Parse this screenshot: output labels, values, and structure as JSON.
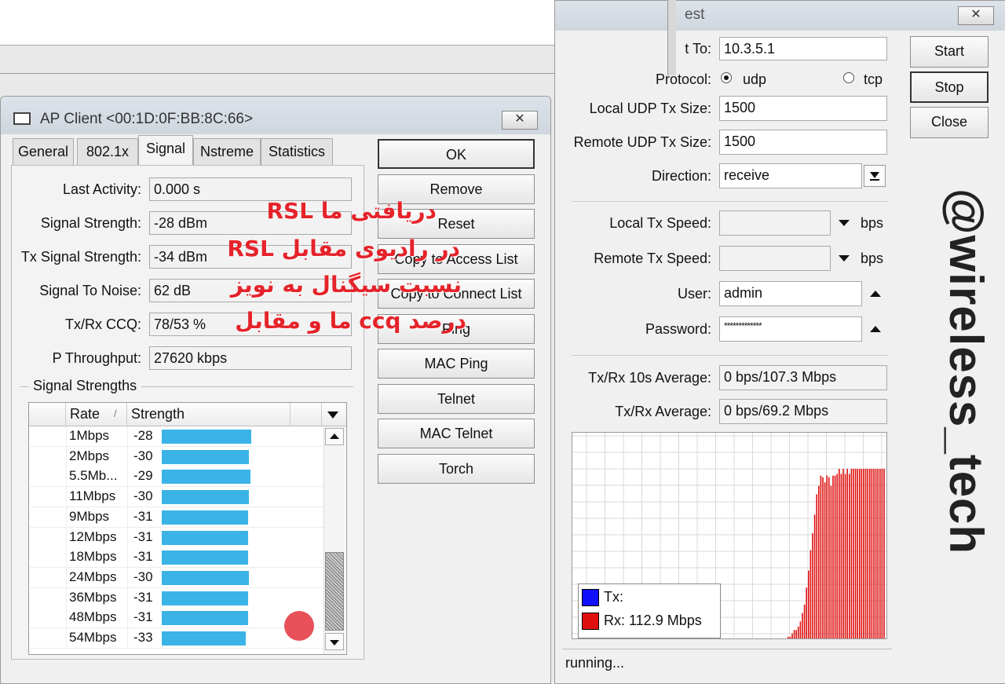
{
  "apclient": {
    "title": "AP Client <00:1D:0F:BB:8C:66>",
    "close_glyph": "✕",
    "tabs": [
      "General",
      "802.1x",
      "Signal",
      "Nstreme",
      "Statistics"
    ],
    "fields": [
      {
        "label": "Last Activity:",
        "value": "0.000 s"
      },
      {
        "label": "Signal Strength:",
        "value": "-28 dBm"
      },
      {
        "label": "Tx Signal Strength:",
        "value": "-34 dBm"
      },
      {
        "label": "Signal To Noise:",
        "value": "62 dB"
      },
      {
        "label": "Tx/Rx CCQ:",
        "value": "78/53 %"
      },
      {
        "label": "P Throughput:",
        "value": "27620 kbps"
      }
    ],
    "group_label": "Signal Strengths",
    "grid": {
      "col_rate": "Rate",
      "sort_glyph": "/",
      "col_strength": "Strength",
      "rows": [
        {
          "rate": "1Mbps",
          "strength": "-28"
        },
        {
          "rate": "2Mbps",
          "strength": "-30"
        },
        {
          "rate": "5.5Mb...",
          "strength": "-29"
        },
        {
          "rate": "11Mbps",
          "strength": "-30"
        },
        {
          "rate": "9Mbps",
          "strength": "-31"
        },
        {
          "rate": "12Mbps",
          "strength": "-31"
        },
        {
          "rate": "18Mbps",
          "strength": "-31"
        },
        {
          "rate": "24Mbps",
          "strength": "-30"
        },
        {
          "rate": "36Mbps",
          "strength": "-31"
        },
        {
          "rate": "48Mbps",
          "strength": "-31"
        },
        {
          "rate": "54Mbps",
          "strength": "-33"
        }
      ]
    },
    "buttons": [
      "OK",
      "Remove",
      "Reset",
      "Copy to Access List",
      "Copy to Connect List",
      "Ping",
      "MAC Ping",
      "Telnet",
      "MAC Telnet",
      "Torch"
    ]
  },
  "bwtest": {
    "title_fragment": "est",
    "close_glyph": "✕",
    "to_label": "t To:",
    "to_value": "10.3.5.1",
    "protocol_label": "Protocol:",
    "protocol_options": [
      "udp",
      "tcp"
    ],
    "protocol_selected": "udp",
    "local_udp_label": "Local UDP Tx Size:",
    "local_udp_value": "1500",
    "remote_udp_label": "Remote UDP Tx Size:",
    "remote_udp_value": "1500",
    "direction_label": "Direction:",
    "direction_value": "receive",
    "local_speed_label": "Local Tx Speed:",
    "remote_speed_label": "Remote Tx Speed:",
    "unit": "bps",
    "user_label": "User:",
    "user_value": "admin",
    "password_label": "Password:",
    "password_value": "*************",
    "avg10_label": "Tx/Rx 10s Average:",
    "avg10_value": "0 bps/107.3 Mbps",
    "avg_label": "Tx/Rx Average:",
    "avg_value": "0 bps/69.2 Mbps",
    "buttons": [
      "Start",
      "Stop",
      "Close"
    ],
    "legend_tx": "Tx:",
    "legend_rx": "Rx:  112.9 Mbps",
    "status": "running...",
    "colors": {
      "tx": "#1010ff",
      "rx": "#e01010"
    },
    "rx_levels": [
      0.01,
      0.01,
      0.03,
      0.05,
      0.05,
      0.07,
      0.1,
      0.15,
      0.2,
      0.3,
      0.4,
      0.52,
      0.62,
      0.73,
      0.85,
      0.9,
      0.96,
      0.95,
      0.92,
      0.96,
      0.95,
      0.9,
      0.96,
      0.96,
      0.97,
      1.0,
      0.97,
      1.0,
      0.97,
      1.0,
      0.97,
      1.0,
      1.0,
      1.0,
      1.0,
      1.0,
      1.0,
      1.0,
      1.0,
      1.0,
      1.0,
      1.0,
      1.0,
      1.0,
      1.0,
      1.0,
      1.0,
      1.0
    ]
  },
  "annotations": [
    "دریافتی ما RSL",
    "در رادیوی مقابل RSL",
    "نسبت سیگنال به نویز",
    "درصد ccq ما و مقابل"
  ],
  "watermark": "@wireless_tech"
}
